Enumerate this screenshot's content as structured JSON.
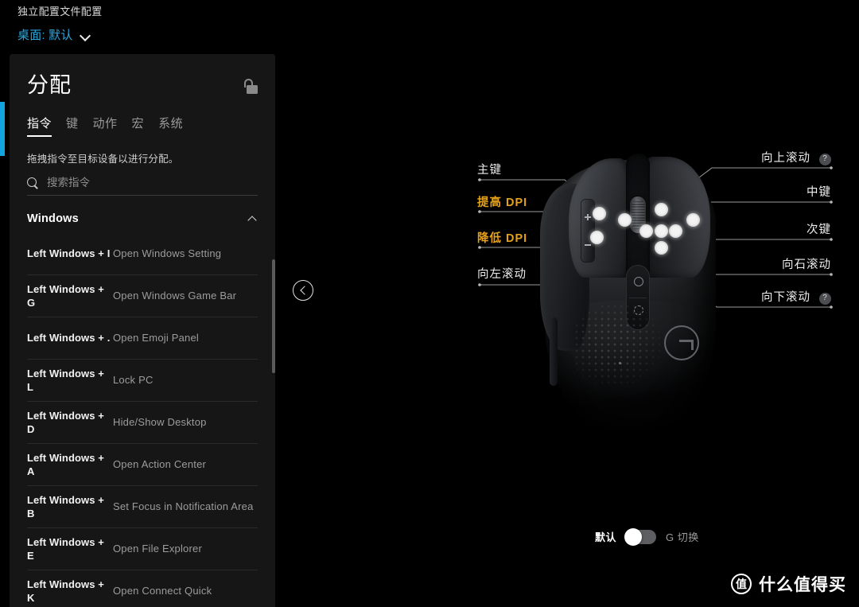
{
  "header": {
    "profile_caption": "独立配置文件配置",
    "desktop_label": "桌面: 默认",
    "chevron_icon": "chevron-down-icon"
  },
  "panel": {
    "title": "分配",
    "lock_icon": "unlock-icon",
    "tabs": [
      {
        "label": "指令",
        "active": true
      },
      {
        "label": "键",
        "active": false
      },
      {
        "label": "动作",
        "active": false
      },
      {
        "label": "宏",
        "active": false
      },
      {
        "label": "系统",
        "active": false
      }
    ],
    "hint": "拖拽指令至目标设备以进行分配。",
    "search": {
      "icon": "search-icon",
      "value": "",
      "placeholder": "搜索指令"
    },
    "group": {
      "title": "Windows",
      "collapse_icon": "chevron-up-icon",
      "expanded": true
    },
    "commands": [
      {
        "keys": "Left Windows + I",
        "desc": "Open Windows Setting"
      },
      {
        "keys": "Left Windows + G",
        "desc": "Open Windows Game Bar"
      },
      {
        "keys": "Left Windows + .",
        "desc": "Open Emoji Panel"
      },
      {
        "keys": "Left Windows + L",
        "desc": "Lock PC"
      },
      {
        "keys": "Left Windows + D",
        "desc": "Hide/Show Desktop"
      },
      {
        "keys": "Left Windows + A",
        "desc": "Open Action Center"
      },
      {
        "keys": "Left Windows + B",
        "desc": "Set Focus in Notification Area"
      },
      {
        "keys": "Left Windows + E",
        "desc": "Open File Explorer"
      },
      {
        "keys": "Left Windows + K",
        "desc": "Open Connect Quick"
      }
    ]
  },
  "collapse_button": {
    "icon": "chevron-left-icon"
  },
  "device": {
    "labels_left": [
      {
        "text": "主键",
        "accent": false
      },
      {
        "text": "提高 DPI",
        "accent": true
      },
      {
        "text": "降低 DPI",
        "accent": true
      },
      {
        "text": "向左滚动",
        "accent": false
      }
    ],
    "labels_right": [
      {
        "text": "向上滚动",
        "help": "?"
      },
      {
        "text": "中键",
        "help": ""
      },
      {
        "text": "次键",
        "help": ""
      },
      {
        "text": "向石滚动",
        "help": ""
      },
      {
        "text": "向下滚动",
        "help": "?"
      }
    ]
  },
  "profile_toggle": {
    "left_label": "默认",
    "right_label": "G 切换",
    "state": "left"
  },
  "watermark": {
    "badge": "值",
    "text": "什么值得买"
  },
  "colors": {
    "accent_cyan": "#13a4e0",
    "desktop_link": "#29a8df",
    "gold": "#e5a11a",
    "panel_bg": "#161616",
    "page_bg": "#000000"
  }
}
